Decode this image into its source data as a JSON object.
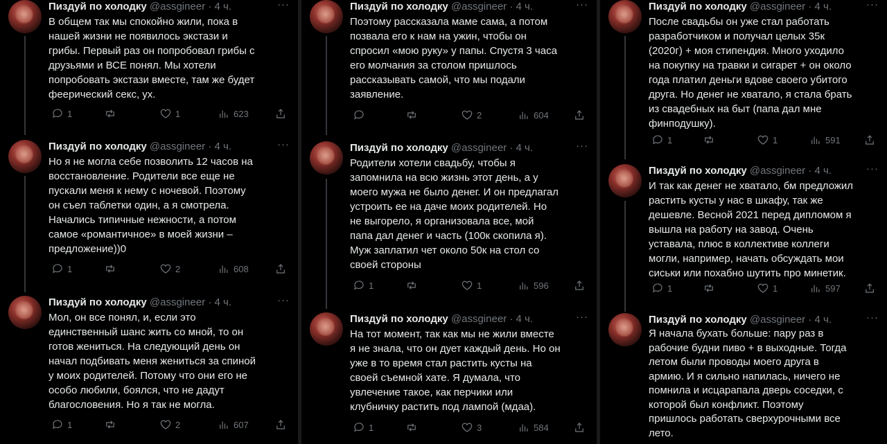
{
  "columns": [
    {
      "tweets": [
        {
          "name": "Пиздуй по холодку",
          "handle": "@assgineer",
          "time": "· 4 ч.",
          "text": "В общем так мы спокойно жили, пока в\nнашей жизни не появилось экстази и\nгрибы. Первый раз он попробовал грибы с\nдрузьями и ВСЕ понял. Мы хотели\nпопробовать экстази вместе, там же будет\nфеерический секс, ух.",
          "replies": "1",
          "retweets": "",
          "likes": "1",
          "views": "623"
        },
        {
          "name": "Пиздуй по холодку",
          "handle": "@assgineer",
          "time": "· 4 ч.",
          "text": "Но я не могла себе позволить 12 часов на\nвосстановление. Родители все еще не\nпускали меня к нему с ночевой. Поэтому\nон съел таблетки один, а я смотрела.\nНачались типичные нежности, а потом\nсамое «романтичное» в моей жизни –\nпредложение))0",
          "replies": "1",
          "retweets": "",
          "likes": "2",
          "views": "608"
        },
        {
          "name": "Пиздуй по холодку",
          "handle": "@assgineer",
          "time": "· 4 ч.",
          "text": "Мол, он все понял, и, если это\nединственный шанс жить со мной, то он\nготов жениться. На следующий день он\nначал подбивать меня жениться за спиной\nу моих родителей. Потому что они его не\nособо любили, боялся, что не дадут\nблагословения. Но я так не могла.",
          "replies": "1",
          "retweets": "",
          "likes": "2",
          "views": "607"
        }
      ]
    },
    {
      "tweets": [
        {
          "name": "Пиздуй по холодку",
          "handle": "@assgineer",
          "time": "· 4 ч.",
          "text": "Поэтому рассказала маме сама, а потом\nпозвала его к нам на ужин, чтобы он\nспросил «мою руку» у папы. Спустя 3 часа\nего молчания за столом пришлось\nрассказывать самой, что мы подали\nзаявление.",
          "replies": "",
          "retweets": "",
          "likes": "2",
          "views": "604"
        },
        {
          "name": "Пиздуй по холодку",
          "handle": "@assgineer",
          "time": "· 4 ч.",
          "text": "Родители хотели свадьбу, чтобы я\nзапомнила на всю жизнь этот день, а у\nмоего мужа не было денег. И он предлагал\nустроить ее на даче моих родителей. Но\nне выгорело, я организовала все, мой\nпапа дал денег и часть (100к скопила я).\nМуж заплатил чет около 50к на стол со\nсвоей стороны",
          "replies": "1",
          "retweets": "",
          "likes": "1",
          "views": "596"
        },
        {
          "name": "Пиздуй по холодку",
          "handle": "@assgineer",
          "time": "· 4 ч.",
          "text": "На тот момент, так как мы не жили вместе\nя не знала, что он дует каждый день. Но он\nуже в то время стал растить кусты на\nсвоей съемной хате. Я думала, что\nувлечение такое, как перчики или\nклубничку растить под лампой (мдаа).",
          "replies": "1",
          "retweets": "",
          "likes": "3",
          "views": "584"
        }
      ]
    },
    {
      "tweets": [
        {
          "name": "Пиздуй по холодку",
          "handle": "@assgineer",
          "time": "· 4 ч.",
          "text": "После свадьбы он уже стал работать\nразработчиком и получал целых 35к\n(2020г) + моя стипендия. Много уходило\nна покупку на травки и сигарет + он около\nгода платил деньги вдове своего убитого\nдруга. Но денег не хватало, я стала брать\nиз свадебных на быт (папа дал мне\nфинподушку).",
          "replies": "1",
          "retweets": "",
          "likes": "1",
          "views": "591"
        },
        {
          "name": "Пиздуй по холодку",
          "handle": "@assgineer",
          "time": "· 4 ч.",
          "text": "И так как денег не хватало, бм предложил\nрастить кусты у нас в шкафу, так же\nдешевле. Весной 2021 перед дипломом я\nвышла на работу на завод. Очень\nуставала, плюс в коллективе коллеги\nмогли, например, начать обсуждать мои\nсиськи или похабно шутить про минетик.",
          "replies": "1",
          "retweets": "",
          "likes": "1",
          "views": "597"
        },
        {
          "name": "Пиздуй по холодку",
          "handle": "@assgineer",
          "time": "· 4 ч.",
          "text": "Я начала бухать больше: пару раз в\nрабочие будни пиво + в выходные. Тогда\nлетом были проводы моего друга в\nармию. И я сильно напилась, ничего не\nпомнила и исцарапала дверь соседки, с\nкоторой был конфликт. Поэтому\nпришлось работать сверхурочными все\nлето.",
          "replies": "",
          "retweets": "",
          "likes": "",
          "views": ""
        }
      ]
    }
  ]
}
